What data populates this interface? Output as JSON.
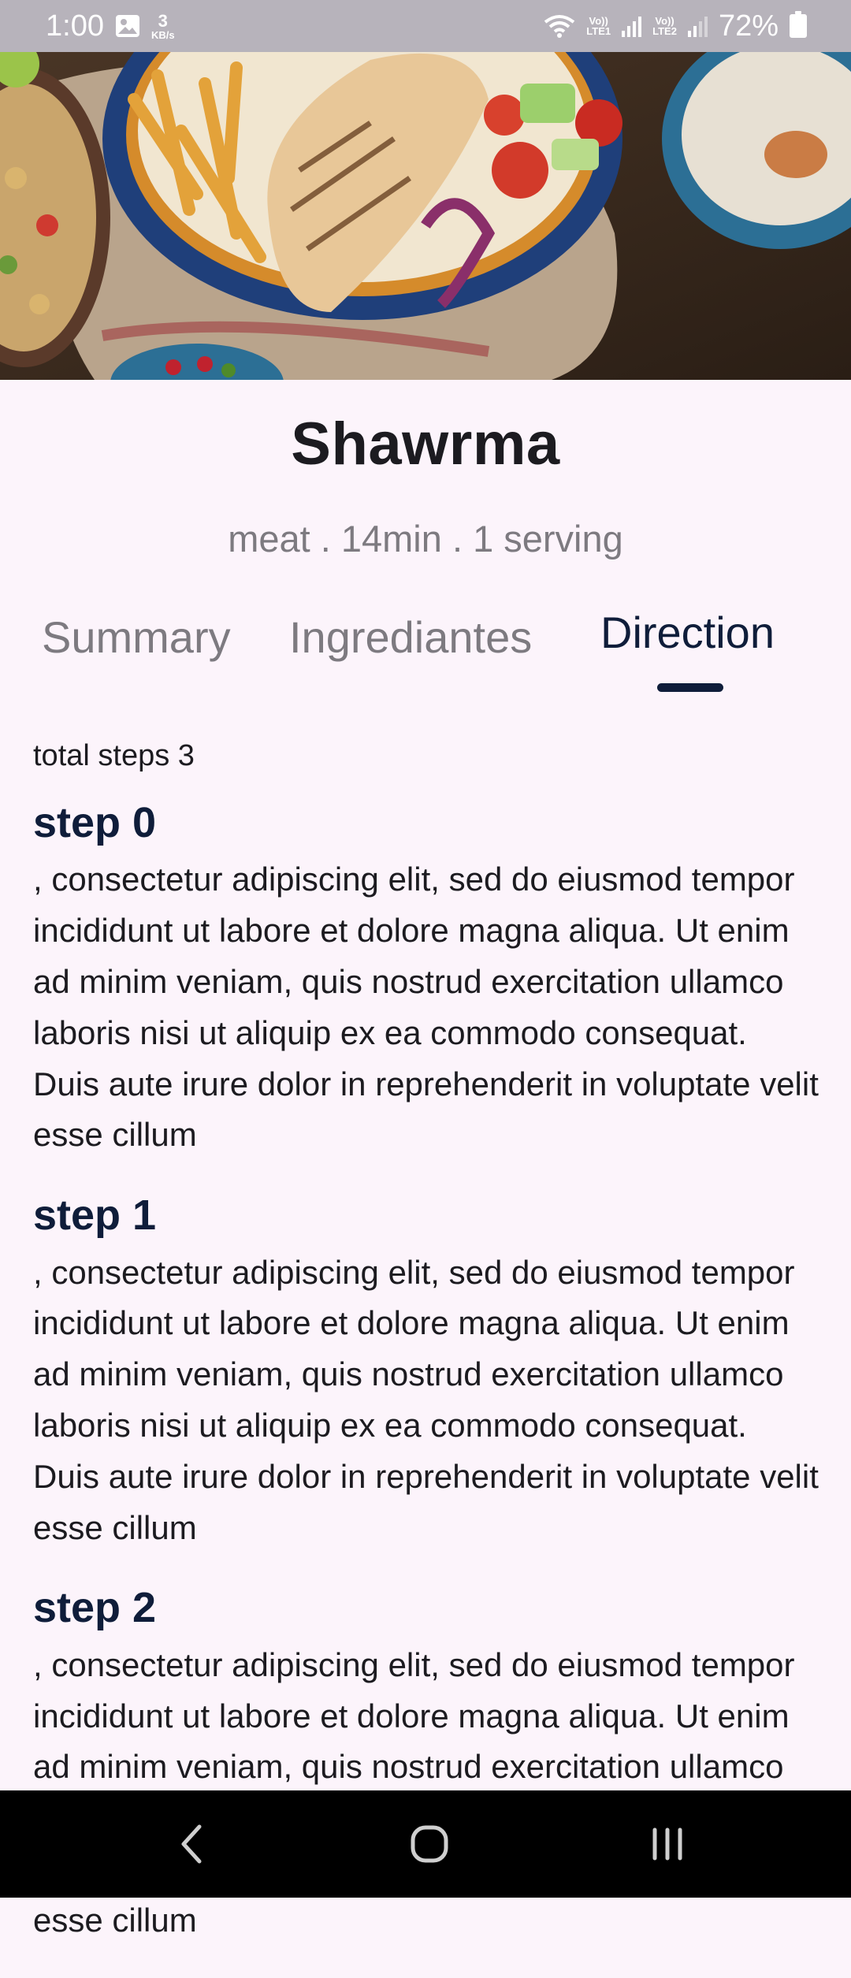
{
  "status_bar": {
    "time": "1:00",
    "speed_value": "3",
    "speed_unit": "KB/s",
    "sim1": "LTE1",
    "sim2": "LTE2",
    "volte": "Vo))",
    "battery": "72%",
    "icons": [
      "gallery-icon",
      "wifi-icon",
      "signal-icon",
      "battery-icon"
    ]
  },
  "hero": {
    "image": "shawarma-plate-photo"
  },
  "recipe": {
    "title": "Shawrma",
    "meta": "meat . 14min . 1 serving"
  },
  "tabs": [
    {
      "label": "Summary",
      "active": false
    },
    {
      "label": "Ingrediantes",
      "active": false
    },
    {
      "label": "Direction",
      "active": true
    }
  ],
  "directions": {
    "total_label": "total steps 3",
    "steps": [
      {
        "title": "step 0",
        "text": ", consectetur adipiscing elit, sed do eiusmod tempor incididunt ut labore et dolore magna aliqua. Ut enim ad minim veniam, quis nostrud exercitation ullamco laboris nisi ut aliquip ex ea commodo consequat. Duis aute irure dolor in reprehenderit in voluptate velit esse cillum"
      },
      {
        "title": "step 1",
        "text": ", consectetur adipiscing elit, sed do eiusmod tempor incididunt ut labore et dolore magna aliqua. Ut enim ad minim veniam, quis nostrud exercitation ullamco laboris nisi ut aliquip ex ea commodo consequat. Duis aute irure dolor in reprehenderit in voluptate velit esse cillum"
      },
      {
        "title": "step 2",
        "text": ", consectetur adipiscing elit, sed do eiusmod tempor incididunt ut labore et dolore magna aliqua. Ut enim ad minim veniam, quis nostrud exercitation ullamco laboris nisi ut aliquip ex ea commodo consequat. Duis aute irure dolor in reprehenderit in voluptate velit esse cillum"
      }
    ]
  },
  "colors": {
    "background": "#fcf4fb",
    "accent": "#0f1d3a",
    "muted": "#7d7a80",
    "status_bar": "#b7b3bb"
  },
  "nav": {
    "icons": [
      "back-icon",
      "home-icon",
      "recents-icon"
    ]
  }
}
